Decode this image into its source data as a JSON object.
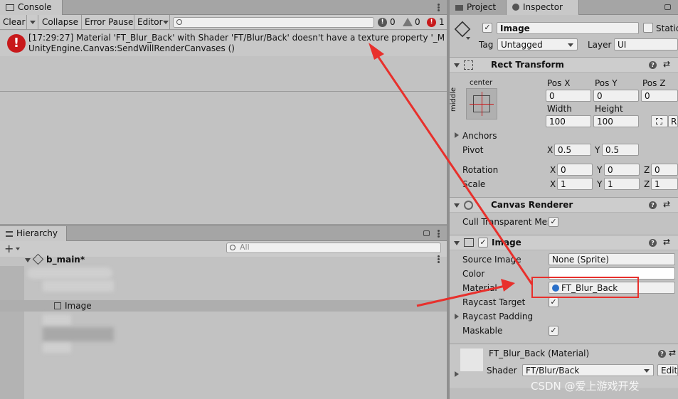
{
  "console": {
    "tab": "Console",
    "toolbar": {
      "clear": "Clear",
      "collapse": "Collapse",
      "error_pause": "Error Pause",
      "editor": "Editor"
    },
    "counts": {
      "info": "0",
      "warning": "0",
      "error": "1"
    },
    "log": {
      "line1": "[17:29:27] Material 'FT_Blur_Back' with Shader 'FT/Blur/Back' doesn't have a texture property '_MainTex'",
      "line2": "UnityEngine.Canvas:SendWillRenderCanvases ()"
    }
  },
  "hierarchy": {
    "tab": "Hierarchy",
    "search_placeholder": "All",
    "scene": "b_main*",
    "items": [
      "Image"
    ]
  },
  "inspector": {
    "tabs": {
      "project": "Project",
      "inspector": "Inspector"
    },
    "object_name": "Image",
    "static_label": "Static",
    "tag_label": "Tag",
    "tag_value": "Untagged",
    "layer_label": "Layer",
    "layer_value": "UI",
    "rect_transform": {
      "title": "Rect Transform",
      "anchor_h": "center",
      "anchor_v": "middle",
      "pos_x_label": "Pos X",
      "pos_y_label": "Pos Y",
      "pos_z_label": "Pos Z",
      "pos_x": "0",
      "pos_y": "0",
      "pos_z": "0",
      "width_label": "Width",
      "height_label": "Height",
      "width": "100",
      "height": "100",
      "anchors": "Anchors",
      "pivot": "Pivot",
      "pivot_x": "0.5",
      "pivot_y": "0.5",
      "rotation": "Rotation",
      "rot_x": "0",
      "rot_y": "0",
      "rot_z": "0",
      "scale": "Scale",
      "scale_x": "1",
      "scale_y": "1",
      "scale_z": "1",
      "x": "X",
      "y": "Y",
      "z": "Z",
      "r_btn": "R"
    },
    "canvas_renderer": {
      "title": "Canvas Renderer",
      "cull": "Cull Transparent Mes"
    },
    "image": {
      "title": "Image",
      "source_image_label": "Source Image",
      "source_image": "None (Sprite)",
      "color_label": "Color",
      "material_label": "Material",
      "material": "FT_Blur_Back",
      "raycast_target": "Raycast Target",
      "raycast_padding": "Raycast Padding",
      "maskable": "Maskable"
    },
    "material_section": {
      "title": "FT_Blur_Back (Material)",
      "shader_label": "Shader",
      "shader": "FT/Blur/Back",
      "edit": "Edit..."
    }
  },
  "watermark": "CSDN @爱上游戏开发",
  "colors": {
    "annotation": "#e8302c",
    "error": "#c8191b",
    "highlight_row": "#aeaeae"
  }
}
